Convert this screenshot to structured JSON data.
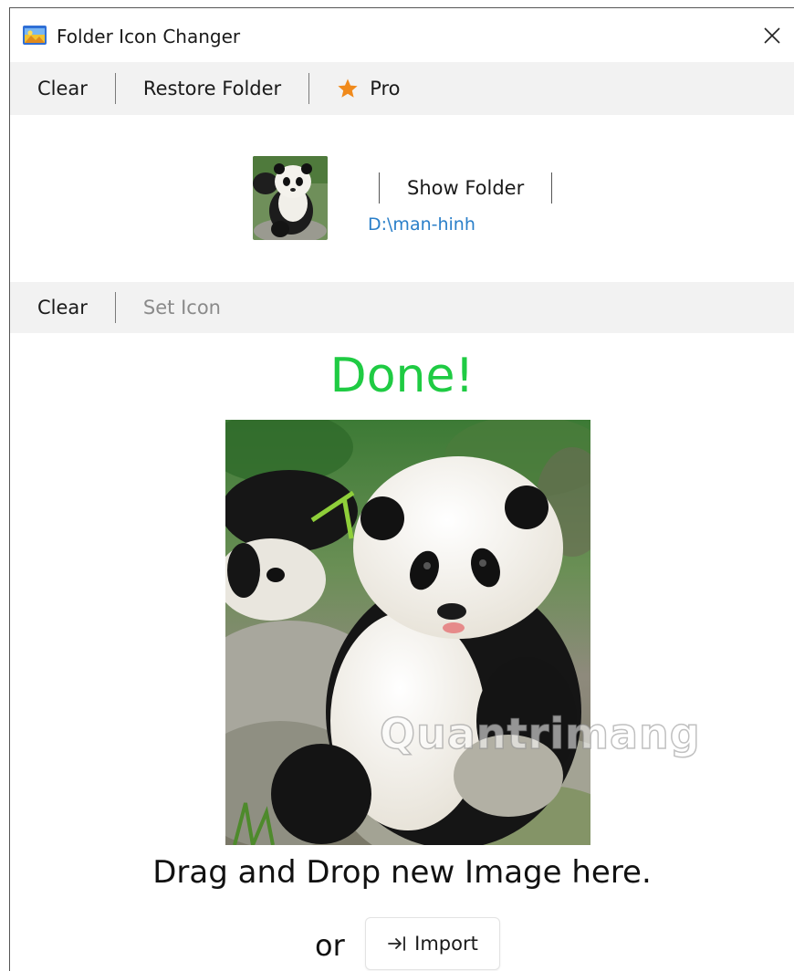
{
  "window": {
    "title": "Folder Icon Changer",
    "close_icon": "close-icon",
    "app_icon": "folder-image-icon"
  },
  "toolbar_top": {
    "clear_label": "Clear",
    "restore_label": "Restore Folder",
    "pro_label": "Pro",
    "pro_icon": "star-icon",
    "pro_color": "#f08a1c"
  },
  "folder": {
    "show_folder_label": "Show Folder",
    "path": "D:\\man-hinh",
    "path_color": "#2a7fc9"
  },
  "toolbar_mid": {
    "clear_label": "Clear",
    "set_icon_label": "Set Icon"
  },
  "status": {
    "text": "Done!",
    "color": "#1fcb43"
  },
  "preview": {
    "watermark": "Quantrimang"
  },
  "dropzone": {
    "text": "Drag and Drop new Image here.",
    "or_text": "or",
    "import_label": "Import",
    "import_icon": "import-arrow-icon"
  }
}
